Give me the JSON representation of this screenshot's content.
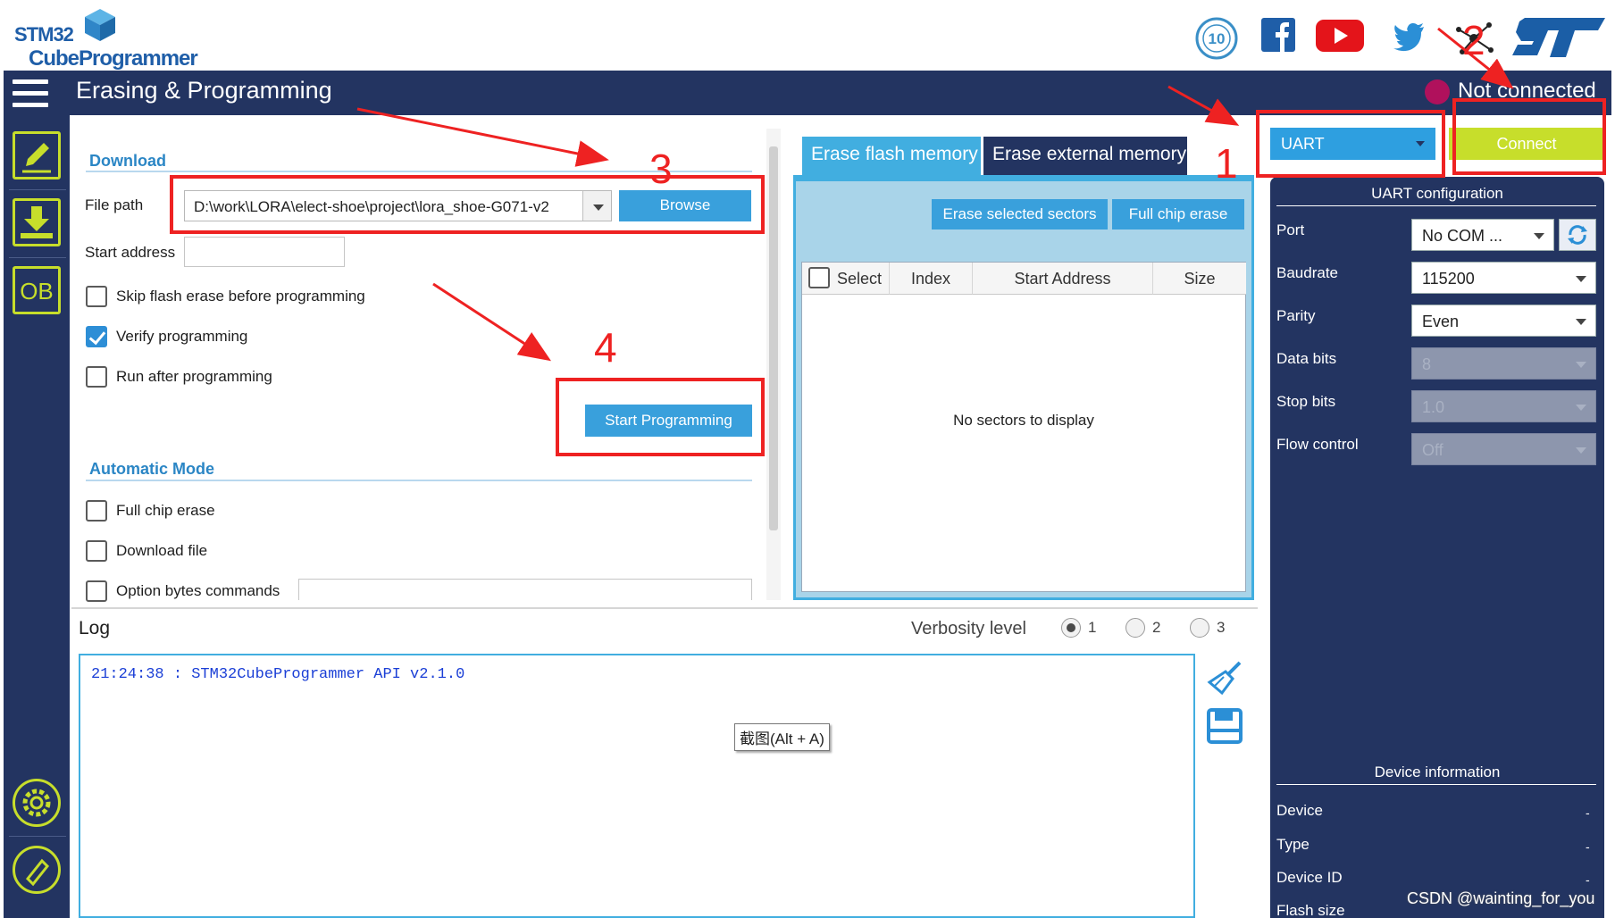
{
  "app": {
    "logo_line1": "STM32",
    "logo_line2": "CubeProgrammer",
    "badge_text": "10",
    "page_title": "Erasing & Programming",
    "connection_status": "Not connected"
  },
  "download": {
    "section_title": "Download",
    "file_path_label": "File path",
    "file_path_value": "D:\\work\\LORA\\elect-shoe\\project\\lora_shoe-G071-v2",
    "browse_label": "Browse",
    "start_address_label": "Start address",
    "start_address_value": "",
    "options": [
      {
        "label": "Skip flash erase before programming",
        "checked": false
      },
      {
        "label": "Verify programming",
        "checked": true
      },
      {
        "label": "Run after programming",
        "checked": false
      }
    ],
    "start_programming_label": "Start Programming"
  },
  "automatic_mode": {
    "section_title": "Automatic Mode",
    "options": [
      {
        "label": "Full chip erase",
        "checked": false
      },
      {
        "label": "Download file",
        "checked": false
      },
      {
        "label": "Option bytes commands",
        "checked": false
      }
    ]
  },
  "erase": {
    "tabs": [
      {
        "label": "Erase flash memory",
        "active": true
      },
      {
        "label": "Erase external memory",
        "active": false
      }
    ],
    "erase_selected_label": "Erase selected sectors",
    "full_chip_erase_label": "Full chip erase",
    "columns": [
      "Select",
      "Index",
      "Start Address",
      "Size"
    ],
    "empty_text": "No sectors to display"
  },
  "log": {
    "title": "Log",
    "verbosity_label": "Verbosity level",
    "verbosity_levels": [
      "1",
      "2",
      "3"
    ],
    "verbosity_selected": "1",
    "lines": [
      "21:24:38 : STM32CubeProgrammer API v2.1.0"
    ],
    "tooltip": "截图(Alt + A)"
  },
  "connection": {
    "interface_value": "UART",
    "connect_label": "Connect",
    "config_title": "UART configuration",
    "fields": [
      {
        "label": "Port",
        "value": "No COM ...",
        "enabled": true
      },
      {
        "label": "Baudrate",
        "value": "115200",
        "enabled": true
      },
      {
        "label": "Parity",
        "value": "Even",
        "enabled": true
      },
      {
        "label": "Data bits",
        "value": "8",
        "enabled": false
      },
      {
        "label": "Stop bits",
        "value": "1.0",
        "enabled": false
      },
      {
        "label": "Flow control",
        "value": "Off",
        "enabled": false
      }
    ]
  },
  "device_info": {
    "title": "Device information",
    "fields": [
      {
        "label": "Device",
        "value": "-"
      },
      {
        "label": "Type",
        "value": "-"
      },
      {
        "label": "Device ID",
        "value": "-"
      },
      {
        "label": "Flash size",
        "value": ""
      }
    ]
  },
  "annotations": {
    "numbers": [
      "1",
      "2",
      "3",
      "4"
    ],
    "watermark": "CSDN @wainting_for_you"
  },
  "colors": {
    "navy": "#233461",
    "accent_green": "#c7de2b",
    "accent_blue": "#39a0dc",
    "annotation_red": "#ee2222"
  }
}
